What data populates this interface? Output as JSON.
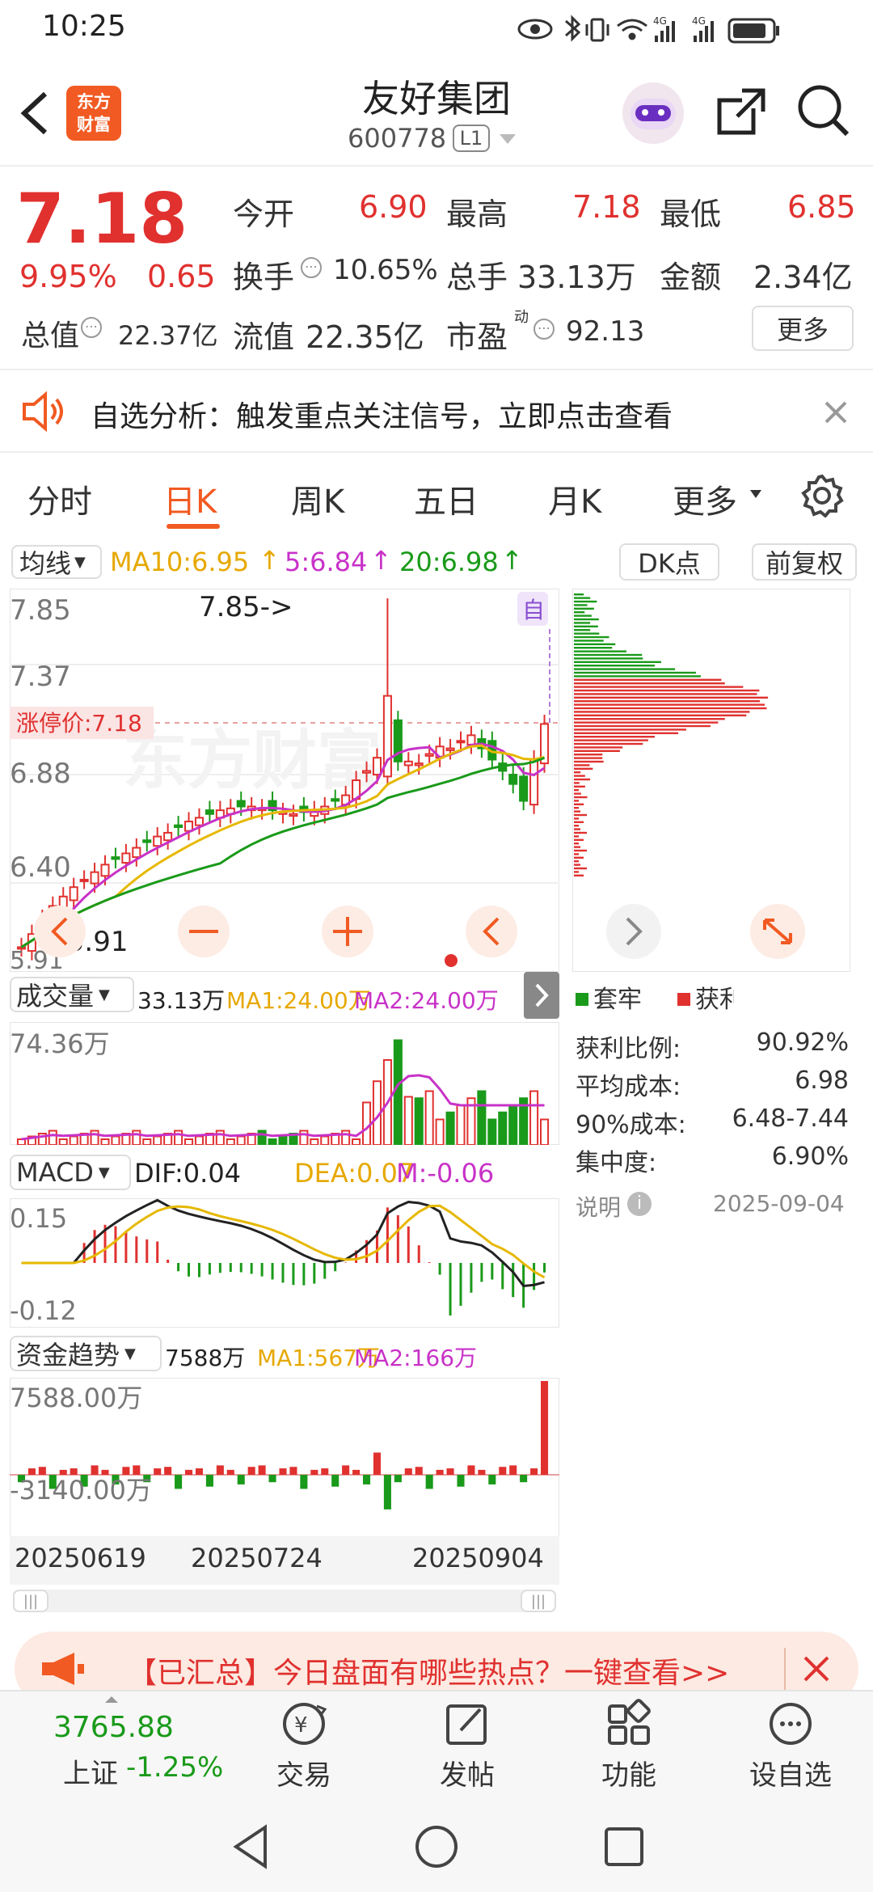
{
  "status": {
    "time": "10:25",
    "net1": "4G",
    "net2": "4G"
  },
  "header": {
    "logo_line1": "东方",
    "logo_line2": "财富",
    "name": "友好集团",
    "code": "600778",
    "badge": "L1"
  },
  "quote": {
    "price": "7.18",
    "pct": "9.95%",
    "chg": "0.65",
    "open_label": "今开",
    "open": "6.90",
    "high_label": "最高",
    "high": "7.18",
    "low_label": "最低",
    "low": "6.85",
    "turn_label": "换手",
    "turn": "10.65%",
    "vol_label": "总手",
    "vol": "33.13万",
    "amt_label": "金额",
    "amt": "2.34亿",
    "mcap_label": "总值",
    "mcap": "22.37亿",
    "float_label": "流值",
    "float": "22.35亿",
    "pe_label": "市盈",
    "pe_sup": "动",
    "pe": "92.13",
    "more": "更多"
  },
  "banner": {
    "text": "自选分析：触发重点关注信号，立即点击查看"
  },
  "tabs": [
    "分时",
    "日K",
    "周K",
    "五日",
    "月K",
    "更多"
  ],
  "chart_ctrl": {
    "ma_select": "均线",
    "ma10": "MA10:6.95",
    "ma5": "5:6.84",
    "ma20": "20:6.98",
    "dk": "DK点",
    "adj": "前复权"
  },
  "kline": {
    "y_top": "7.85",
    "y2": "7.37",
    "y3": "6.88",
    "y4": "6.40",
    "y_bot": "5.91",
    "max_note": "7.85->",
    "min_note": "<-5.91",
    "limit": "涨停价:7.18",
    "self_tag": "自"
  },
  "vol_panel": {
    "select": "成交量",
    "val": "33.13万",
    "ma1": "MA1:24.00万",
    "ma2": "MA2:24.00万",
    "y_top": "74.36万"
  },
  "macd_panel": {
    "select": "MACD",
    "dif": "DIF:0.04",
    "dea": "DEA:0.07",
    "m": "M:-0.06",
    "y_top": "0.15",
    "y_bot": "-0.12"
  },
  "fund_panel": {
    "select": "资金趋势",
    "val": "7588万",
    "ma1": "MA1:567万",
    "ma2": "MA2:166万",
    "y_top": "7588.00万",
    "y_bot": "-3140.00万"
  },
  "dates": [
    "20250619",
    "20250724",
    "20250904"
  ],
  "chip": {
    "legend_trap": "套牢",
    "legend_profit": "获利",
    "rows": [
      {
        "k": "获利比例:",
        "v": "90.92%"
      },
      {
        "k": "平均成本:",
        "v": "6.98"
      },
      {
        "k": "90%成本:",
        "v": "6.48-7.44"
      },
      {
        "k": "集中度:",
        "v": "6.90%"
      }
    ],
    "note": "说明",
    "date": "2025-09-04"
  },
  "ad": {
    "text": "【已汇总】今日盘面有哪些热点？一键查看>>"
  },
  "bottom": {
    "index_val": "3765.88",
    "index_name": "上证",
    "index_pct": "-1.25%",
    "trade": "交易",
    "post": "发帖",
    "func": "功能",
    "watch": "设自选"
  },
  "chart_data": {
    "type": "candlestick",
    "ylim": [
      5.91,
      7.85
    ],
    "x_ticks": [
      "20250619",
      "20250724",
      "20250904"
    ],
    "close": [
      5.99,
      6.06,
      6.14,
      6.21,
      6.26,
      6.31,
      6.35,
      6.39,
      6.43,
      6.46,
      6.49,
      6.52,
      6.55,
      6.58,
      6.6,
      6.63,
      6.66,
      6.68,
      6.7,
      6.72,
      6.73,
      6.74,
      6.74,
      6.73,
      6.72,
      6.71,
      6.7,
      6.71,
      6.72,
      6.74,
      6.77,
      6.8,
      6.88,
      6.93,
      7.0,
      7.33,
      6.98,
      6.98,
      6.97,
      7.02,
      7.06,
      7.05,
      7.09,
      7.12,
      7.05,
      6.99,
      6.93,
      6.86,
      6.77,
      6.99,
      7.18
    ],
    "ma10": 6.95,
    "ma5": 6.84,
    "ma20": 6.98
  }
}
